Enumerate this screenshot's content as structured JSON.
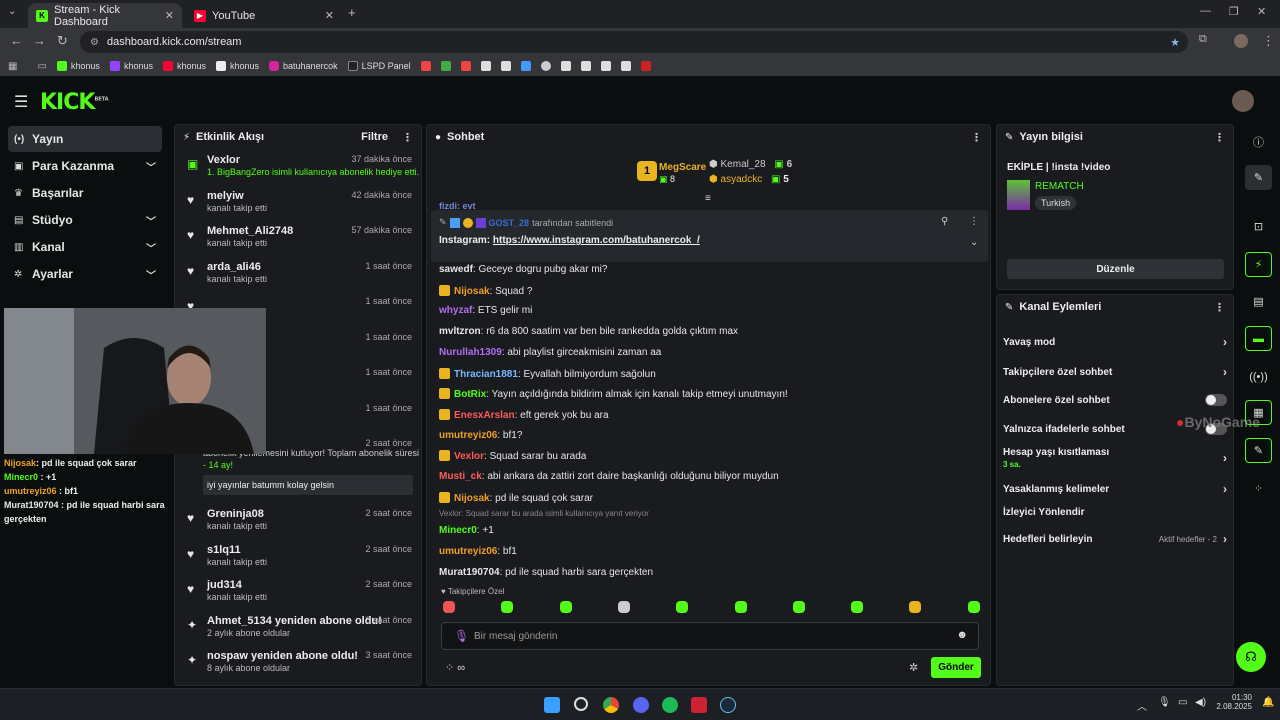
{
  "browser": {
    "tabs": [
      {
        "title": "Stream - Kick Dashboard",
        "close": "✕"
      },
      {
        "title": "YouTube",
        "close": "✕"
      }
    ],
    "new_tab": "+",
    "url": "dashboard.kick.com/stream",
    "bookmarks": [
      "khonus",
      "khonus",
      "khonus",
      "khonus",
      "batuhanercok",
      "LSPD Panel"
    ]
  },
  "brand": {
    "logo": "KICK",
    "beta": "BETA",
    "accent": "#53fc18"
  },
  "nav": {
    "items": [
      {
        "label": "Yayın",
        "icon": "broadcast-icon",
        "active": true
      },
      {
        "label": "Para Kazanma",
        "icon": "money-icon",
        "chevron": true
      },
      {
        "label": "Başarılar",
        "icon": "trophy-icon"
      },
      {
        "label": "Stüdyo",
        "icon": "studio-icon",
        "chevron": true
      },
      {
        "label": "Kanal",
        "icon": "channel-icon",
        "chevron": true
      },
      {
        "label": "Ayarlar",
        "icon": "gear-icon",
        "chevron": true
      }
    ]
  },
  "activity": {
    "title": "Etkinlik Akışı",
    "filter": "Filtre",
    "items": [
      {
        "name": "Vexlor",
        "sub": "1. BigBangZero isimli kullanıcıya abonelik hediye etti.",
        "time": "37 dakika önce",
        "icon": "gift-icon",
        "subcolor": "#53fc18"
      },
      {
        "name": "melyiw",
        "sub": "kanalı takip etti",
        "time": "42 dakika önce",
        "icon": "heart-icon"
      },
      {
        "name": "Mehmet_Ali2748",
        "sub": "kanalı takip etti",
        "time": "57 dakika önce",
        "icon": "heart-icon"
      },
      {
        "name": "arda_ali46",
        "sub": "kanalı takip etti",
        "time": "1 saat önce",
        "icon": "heart-icon"
      },
      {
        "name": "",
        "sub": "",
        "time": "1 saat önce",
        "icon": "heart-icon"
      },
      {
        "name": "",
        "sub": "",
        "time": "1 saat önce",
        "icon": "heart-icon"
      },
      {
        "name": "07",
        "sub": "",
        "time": "1 saat önce",
        "icon": "heart-icon"
      },
      {
        "name": "",
        "sub": "",
        "time": "1 saat önce",
        "icon": "heart-icon"
      }
    ],
    "resub": {
      "time": "2 saat önce",
      "text": "abonelik yenilemesini kutluyor! Toplam abonelik süresi",
      "months": "- 14 ay!",
      "message": "iyi yayınlar batumm kolay gelsin"
    },
    "items2": [
      {
        "name": "Greninja08",
        "sub": "kanalı takip etti",
        "time": "2 saat önce",
        "icon": "heart-icon"
      },
      {
        "name": "s1lq11",
        "sub": "kanalı takip etti",
        "time": "2 saat önce",
        "icon": "heart-icon"
      },
      {
        "name": "jud314",
        "sub": "kanalı takip etti",
        "time": "2 saat önce",
        "icon": "heart-icon"
      },
      {
        "name": "Ahmet_5134 yeniden abone oldu!",
        "sub": "2 aylık abone oldular",
        "time": "3 saat önce",
        "icon": "sparkle-icon"
      },
      {
        "name": "nospaw yeniden abone oldu!",
        "sub": "8 aylık abone oldular",
        "time": "3 saat önce",
        "icon": "sparkle-icon"
      }
    ]
  },
  "overlay_chat": [
    {
      "user": "Nijosak",
      "text": ": pd ile squad çok sarar",
      "color": "#f0a020"
    },
    {
      "user": "Minecr0",
      "text": " : +1",
      "color": "#53fc18"
    },
    {
      "user": "umutreyiz06",
      "text": " : bf1",
      "color": "#f0a020"
    },
    {
      "user": "Murat190704",
      "text": " : pd ile squad harbi sara gerçekten",
      "color": "#e6e6e6"
    }
  ],
  "chat": {
    "title": "Sohbet",
    "top": [
      {
        "rank": "1",
        "name": "MegScare",
        "count": "8"
      },
      {
        "name": "Kemal_28",
        "count": "6"
      },
      {
        "name": "asyadckc",
        "count": "5"
      }
    ],
    "pinned": {
      "by": "GOST_28",
      "label": "tarafından sabitlendi",
      "prefix": "Instagram:",
      "link": "https://www.instagram.com/batuhanercok_/"
    },
    "cut": "fizdi: evt",
    "messages": [
      {
        "user": "sawedf",
        "text": ": Geceye dogru pubg akar mi?",
        "color": "#e6e6e6"
      },
      {
        "user": "Nijosak",
        "text": ": Squad ?",
        "color": "#f0a020",
        "badge": true
      },
      {
        "user": "whyzaf",
        "text": ": ETS gelir mi",
        "color": "#b070f0"
      },
      {
        "user": "mvltzron",
        "text": ": r6 da 800 saatim var ben bile rankedda golda çıktım max",
        "color": "#e6e6e6"
      },
      {
        "user": "Nurullah1309",
        "text": ": abi playlist girceakmisini zaman aa",
        "color": "#b070f0"
      },
      {
        "user": "Thracian1881",
        "text": ": Eyvallah bilmiyordum sağolun",
        "color": "#7ab8ff",
        "badge": true
      },
      {
        "user": "BotRix",
        "text": ": Yayın açıldığında bildirim almak için kanalı takip etmeyi unutmayın!",
        "color": "#53fc18",
        "badge": true
      },
      {
        "user": "EnesxArslan",
        "text": ": eft gerek yok bu ara",
        "color": "#ff5b5b",
        "badge": true
      },
      {
        "user": "umutreyiz06",
        "text": ": bf1?",
        "color": "#f0a020"
      },
      {
        "user": "Vexlor",
        "text": ": Squad sarar bu arada",
        "color": "#ff5b5b",
        "badge": true
      },
      {
        "user": "Musti_ck",
        "text": ": abi ankara da zattiri zort daire başkanlığı olduğunu biliyor muydun",
        "color": "#ff5b5b"
      },
      {
        "user": "Nijosak",
        "text": ": pd ile squad çok sarar",
        "color": "#f0a020",
        "badge": true
      },
      {
        "user": "Minecr0",
        "text": ": +1",
        "color": "#53fc18",
        "reply": "Vexlor: Squad sarar bu arada isimli kullanıcıya yanıt veriyor"
      },
      {
        "user": "umutreyiz06",
        "text": ": bf1",
        "color": "#f0a020"
      },
      {
        "user": "Murat190704",
        "text": ": pd ile squad harbi sara gerçekten",
        "color": "#e6e6e6"
      }
    ],
    "followers_only": "Takipçilere Özel",
    "input_placeholder": "Bir mesaj gönderin",
    "send": "Gönder"
  },
  "stream_info": {
    "title": "Yayın bilgisi",
    "stream_title": "EKİPLE | !insta !video",
    "category": "REMATCH",
    "tag": "Turkish",
    "edit": "Düzenle"
  },
  "channel_actions": {
    "title": "Kanal Eylemleri",
    "rows": [
      {
        "label": "Yavaş mod",
        "type": "arrow"
      },
      {
        "label": "Takipçilere özel sohbet",
        "type": "arrow"
      },
      {
        "label": "Abonelere özel sohbet",
        "type": "toggle"
      },
      {
        "label": "Yalnızca ifadelerle sohbet",
        "type": "toggle"
      },
      {
        "label": "Hesap yaşı kısıtlaması",
        "sub": "3 sa.",
        "type": "arrow"
      },
      {
        "label": "Yasaklanmış kelimeler",
        "type": "arrow"
      },
      {
        "label": "İzleyici Yönlendir",
        "type": "none"
      },
      {
        "label": "Hedefleri belirleyin",
        "extra": "Aktif hedefler - 2",
        "type": "arrow"
      }
    ]
  },
  "watermark": "ByNoGame",
  "taskbar": {
    "time": "01:30",
    "date": "2.08.2025"
  }
}
